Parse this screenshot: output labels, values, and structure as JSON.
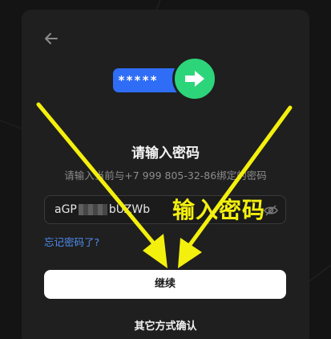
{
  "header": {
    "back_icon": "arrow-left-icon"
  },
  "hero": {
    "masked_text": "*****",
    "arrow_icon": "arrow-right-icon",
    "pill_color": "#2f6df6",
    "circle_color": "#2dd57a"
  },
  "title": "请输入密码",
  "subtitle": "请输入当前与+7 999 805-32-86绑定的密码",
  "password_field": {
    "value_start": "aGP",
    "value_end": "bUZWb",
    "eye_icon": "eye-slash-icon"
  },
  "forgot_link": "忘记密码了?",
  "continue_button": "继续",
  "other_methods": "其它方式确认",
  "annotation": {
    "label": "输入密码",
    "color": "#f4f00e"
  },
  "colors": {
    "accent_link": "#4e8cf0",
    "card_bg": "#1f1f1f"
  }
}
